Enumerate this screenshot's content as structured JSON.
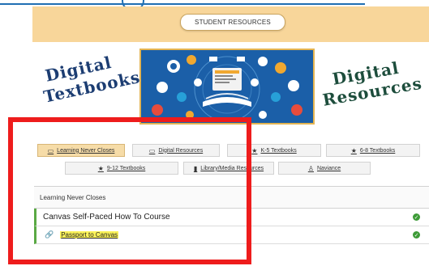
{
  "header": {
    "button_label": "STUDENT RESOURCES"
  },
  "banner": {
    "left_title_line1": "Digital",
    "left_title_line2": "Textbooks",
    "right_title_line1": "Digital",
    "right_title_line2": "Resources"
  },
  "tabs": [
    {
      "label": "Learning Never Closes",
      "icon": "laptop-icon",
      "active": true
    },
    {
      "label": "Digital Resources",
      "icon": "laptop-icon",
      "active": false
    },
    {
      "label": "K-5 Textbooks",
      "icon": "star-icon",
      "active": false
    },
    {
      "label": "6-8 Textbooks",
      "icon": "star-icon",
      "active": false
    },
    {
      "label": "9-12 Textbooks",
      "icon": "star-icon",
      "active": false
    },
    {
      "label": "Library/Media Resources",
      "icon": "book-icon",
      "active": false
    },
    {
      "label": "Naviance",
      "icon": "person-icon",
      "active": false
    }
  ],
  "panel": {
    "heading": "Learning Never Closes",
    "course_title": "Canvas Self-Paced How To Course",
    "link_label": "Passport to Canvas"
  },
  "colors": {
    "header_band": "#f8d69a",
    "active_tab": "#f6dca8",
    "highlight": "#fbf35a",
    "check": "#3d9b37",
    "annotation_box": "#ee1c1c",
    "title_blue": "#1c3d72",
    "title_green": "#1d4d3c"
  }
}
